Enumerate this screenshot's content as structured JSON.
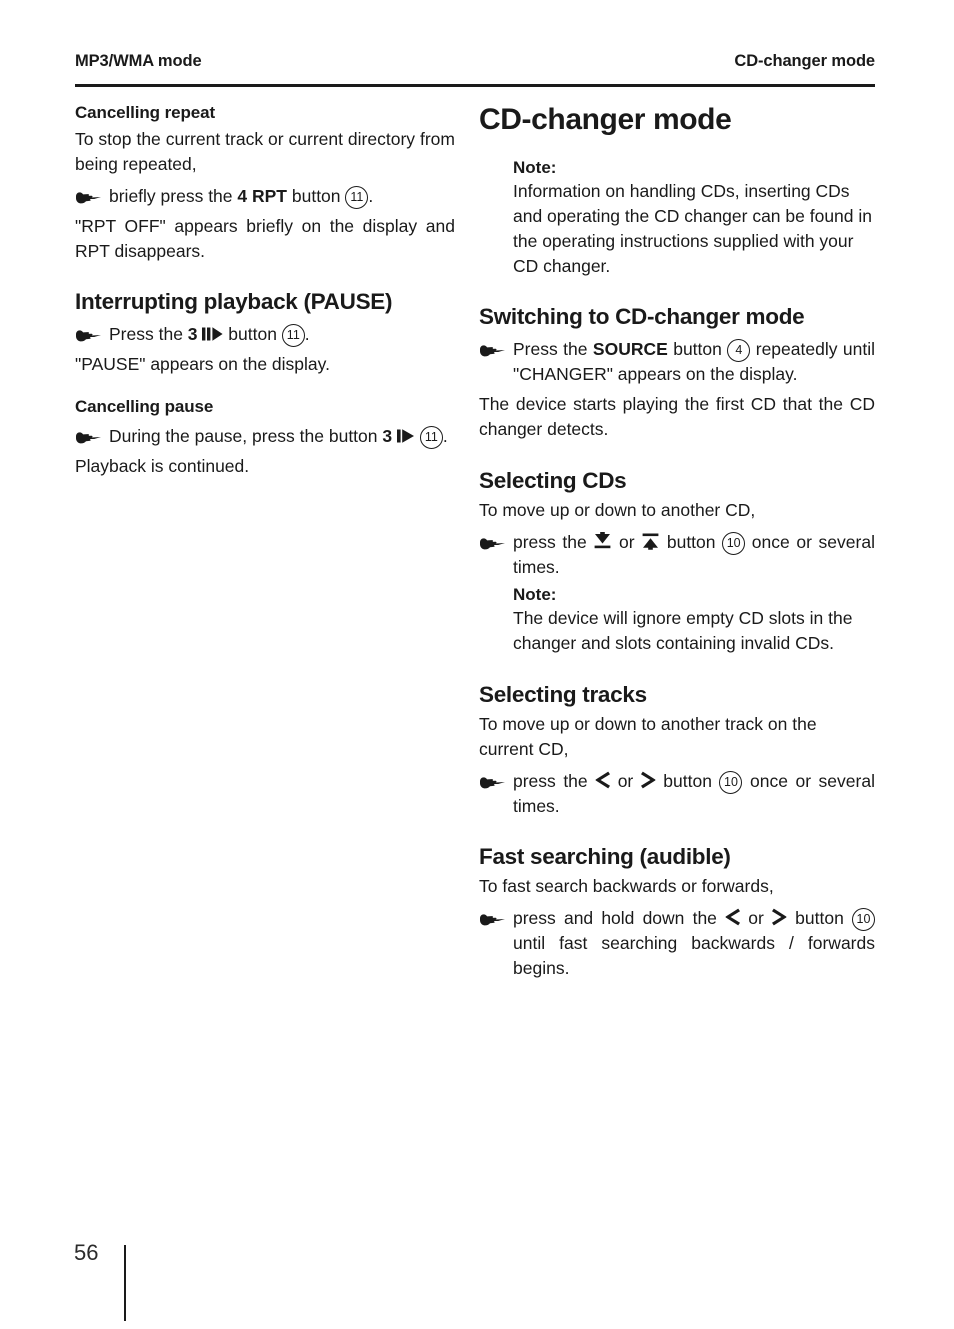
{
  "header": {
    "left": "MP3/WMA mode",
    "right": "CD-changer mode"
  },
  "left_column": {
    "sections": [
      {
        "sub_heading": "Cancelling repeat",
        "intro": "To stop the current track or current directory from being repeated,",
        "step_pre": "briefly press the ",
        "step_bold": "4 RPT",
        "step_mid": " button ",
        "step_ref": "11",
        "step_post": ".",
        "outro": "\"RPT OFF\" appears briefly on the display and RPT disappears."
      },
      {
        "heading": "Interrupting playback (PAUSE)",
        "step_pre": "Press the ",
        "step_bold": "3",
        "step_icon": "pause-play-icon",
        "step_mid": " button ",
        "step_ref": "11",
        "step_post": ".",
        "outro": "\"PAUSE\" appears on the display."
      },
      {
        "sub_heading": "Cancelling pause",
        "step_pre": "During the pause, press the button ",
        "step_bold": "3",
        "step_icon": "play-icon",
        "step_mid": " ",
        "step_ref": "11",
        "step_post": ".",
        "outro": "Playback is continued."
      }
    ]
  },
  "right_column": {
    "title": "CD-changer mode",
    "note_1": {
      "label": "Note:",
      "body": "Information on handling CDs, inserting CDs and operating the CD changer can be found in the operating instructions supplied with your CD changer."
    },
    "sections": [
      {
        "heading": "Switching to CD-changer mode",
        "step_pre": "Press the ",
        "step_bold": "SOURCE",
        "step_mid": " button ",
        "step_ref": "4",
        "step_post": " repeatedly until \"CHANGER\" appears on the display.",
        "outro": "The device starts playing the first CD that the CD changer detects."
      },
      {
        "heading": "Selecting CDs",
        "intro": "To move up or down to another CD,",
        "step_pre": "press the ",
        "icon_a": "cd-down-icon",
        "step_or": " or ",
        "icon_b": "cd-up-icon",
        "step_mid": " button ",
        "step_ref": "10",
        "step_post": " once or several times.",
        "note": {
          "label": "Note:",
          "body": "The device will ignore empty CD slots in the changer and slots containing invalid CDs."
        }
      },
      {
        "heading": "Selecting tracks",
        "intro": "To move up or down to another track on the current CD,",
        "step_pre": "press the ",
        "icon_a": "chevron-left-icon",
        "step_or": " or ",
        "icon_b": "chevron-right-icon",
        "step_mid": " button ",
        "step_ref": "10",
        "step_post": " once or several times."
      },
      {
        "heading": "Fast searching (audible)",
        "intro": "To fast search backwards or forwards,",
        "step_pre": "press and hold down the ",
        "icon_a": "chevron-left-icon",
        "step_or": " or ",
        "icon_b": "chevron-right-icon",
        "step_mid": " button ",
        "step_ref": "10",
        "step_post": " until fast searching backwards / forwards begins."
      }
    ]
  },
  "footer": {
    "page_number": "56"
  }
}
